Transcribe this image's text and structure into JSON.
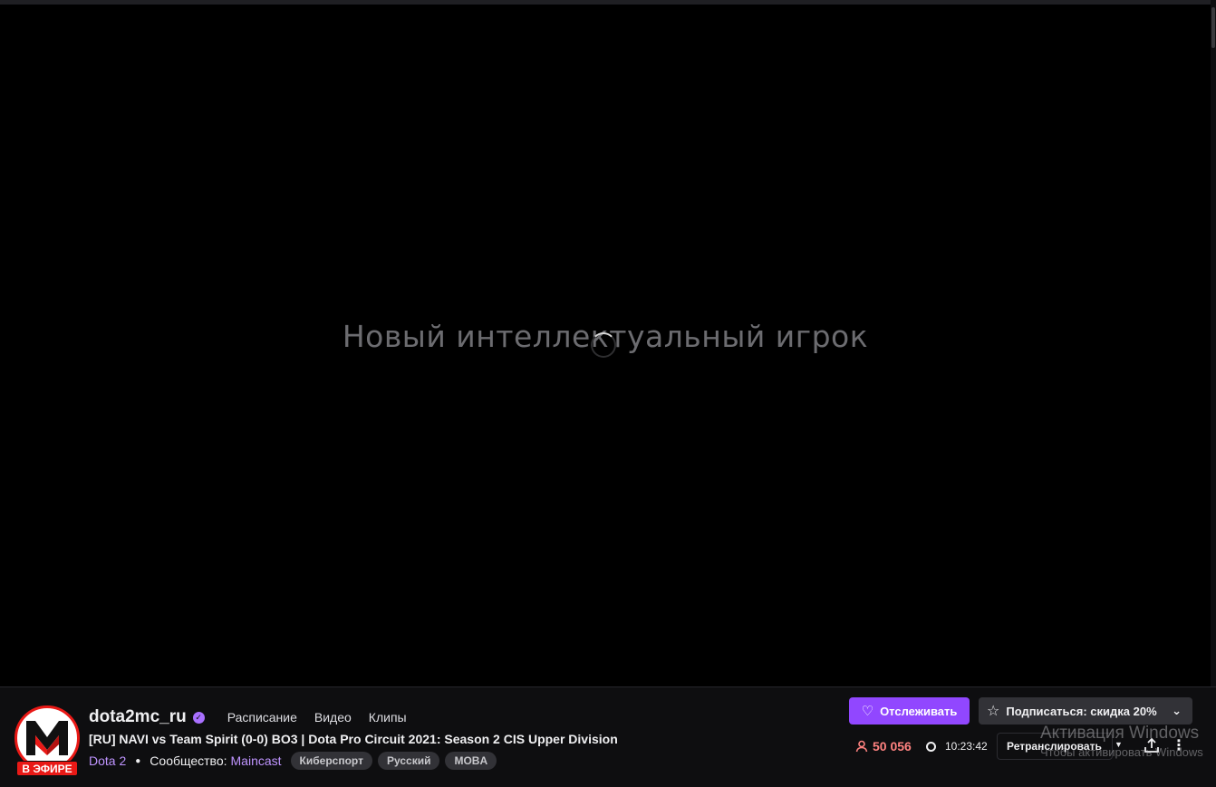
{
  "player": {
    "overlay_text": "Новый интеллектуальный игрок"
  },
  "channel": {
    "name": "dota2mc_ru",
    "live_badge": "В ЭФИРЕ",
    "nav": [
      "Расписание",
      "Видео",
      "Клипы"
    ]
  },
  "stream": {
    "title": "[RU] NAVI vs Team Spirit (0-0) BO3 | Dota Pro Circuit 2021: Season 2 CIS Upper Division",
    "game": "Dota 2",
    "community_label": "Сообщество:",
    "community": "Maincast",
    "tags": [
      "Киберспорт",
      "Русский",
      "MOBA"
    ],
    "viewers": "50 056",
    "uptime": "10:23:42"
  },
  "actions": {
    "follow": "Отслеживать",
    "subscribe": "Подписаться: скидка 20%",
    "rebroadcast": "Ретранслировать"
  },
  "windows_watermark": {
    "line1": "Активация Windows",
    "line2": "Чтобы активировать Windows"
  },
  "colors": {
    "accent": "#9147ff",
    "live": "#e91916",
    "link": "#bf94ff",
    "viewers": "#ff8280"
  }
}
